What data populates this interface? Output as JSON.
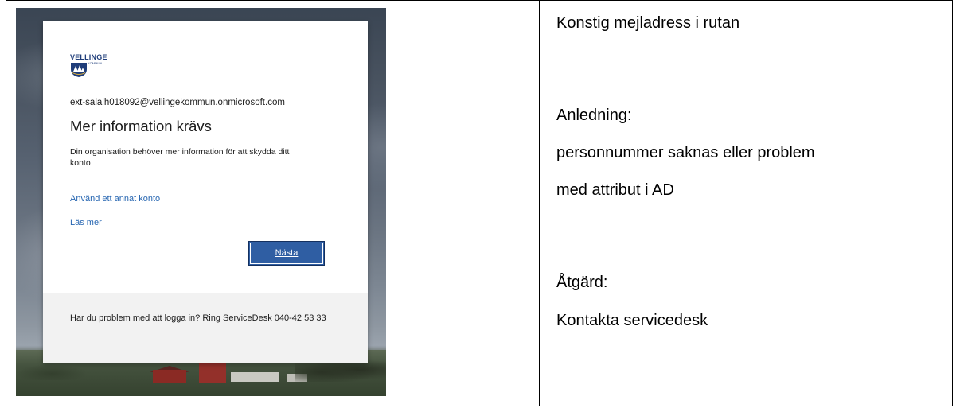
{
  "screenshot": {
    "logo": {
      "name": "VELLINGE",
      "sub": "KOMMUN"
    },
    "email": "ext-salalh018092@vellingekommun.onmicrosoft.com",
    "heading": "Mer information krävs",
    "description": "Din organisation behöver mer information för att skydda ditt konto",
    "links": {
      "other_account": "Använd ett annat konto",
      "read_more": "Läs mer"
    },
    "next_button": "Nästa",
    "footer": "Har du problem med att logga in? Ring ServiceDesk 040-42 53 33"
  },
  "notes": {
    "line1": "Konstig mejladress i rutan",
    "line2": "Anledning:",
    "line3": "personnummer saknas eller problem",
    "line4": "med attribut i AD",
    "line5": "Åtgärd:",
    "line6": "Kontakta servicedesk"
  },
  "colors": {
    "link": "#2867b2",
    "button": "#2f5ea3"
  }
}
